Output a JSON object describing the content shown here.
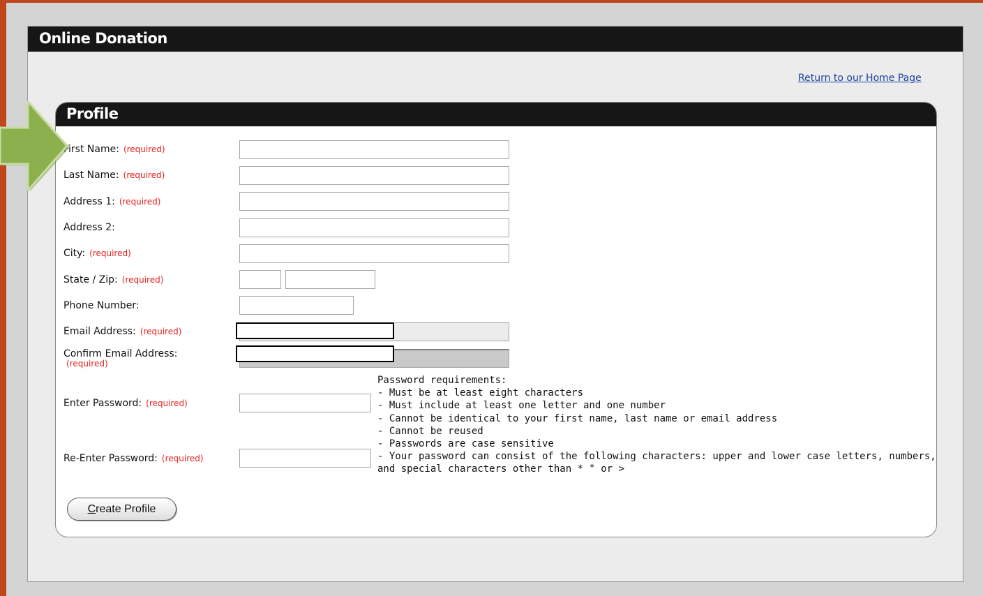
{
  "app": {
    "title": "Online Donation",
    "home_link": "Return to our Home Page"
  },
  "profile": {
    "title": "Profile",
    "required_text": "(required)",
    "fields": {
      "first_name": {
        "label": "First Name:",
        "value": ""
      },
      "last_name": {
        "label": "Last Name:",
        "value": ""
      },
      "address1": {
        "label": "Address 1:",
        "value": ""
      },
      "address2": {
        "label": "Address 2:",
        "value": ""
      },
      "city": {
        "label": "City:",
        "value": ""
      },
      "state_zip": {
        "label": "State / Zip:",
        "state": "",
        "zip": ""
      },
      "phone": {
        "label": "Phone Number:",
        "value": ""
      },
      "email": {
        "label": "Email Address:",
        "value": ""
      },
      "confirm_email": {
        "label": "Confirm Email Address:",
        "value": ""
      },
      "password": {
        "label": "Enter Password:",
        "value": ""
      },
      "reenter_password": {
        "label": "Re-Enter Password:",
        "value": ""
      }
    },
    "password_requirements": [
      "Password requirements:",
      "- Must be at least eight characters",
      "- Must include at least one letter and one number",
      "- Cannot be identical to your first name, last name or email address",
      "- Cannot be reused",
      "- Passwords are case sensitive",
      "- Your password can consist of the following characters: upper and lower case letters, numbers,",
      "and special characters other than * \" or >"
    ],
    "create_button": {
      "accel": "C",
      "rest": "reate Profile"
    }
  },
  "colors": {
    "accent_border": "#c0461e",
    "header_bg": "#161616",
    "required": "#e8201e",
    "link": "#1a3fa0",
    "arrow": "#8db04e"
  },
  "icons": {
    "pointer": "arrow-right-icon"
  }
}
